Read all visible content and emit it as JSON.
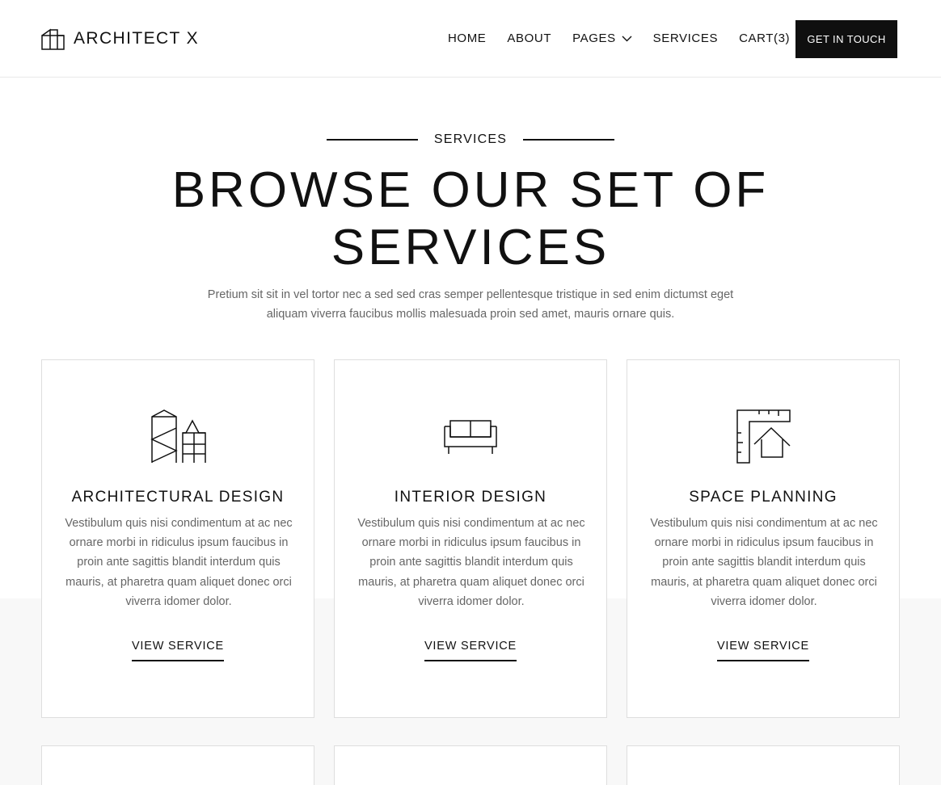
{
  "brand": {
    "name": "ARCHITECT X",
    "logo_icon": "building-outline-icon"
  },
  "nav": {
    "items": [
      {
        "label": "HOME"
      },
      {
        "label": "ABOUT"
      },
      {
        "label": "PAGES",
        "has_dropdown": true
      },
      {
        "label": "SERVICES"
      },
      {
        "label": "CART(3)"
      }
    ],
    "cta_label": "GET IN TOUCH"
  },
  "hero": {
    "eyebrow": "SERVICES",
    "title": "BROWSE OUR SET OF SERVICES",
    "description": "Pretium sit sit in vel tortor nec a sed sed cras semper pellentesque tristique in sed enim dictumst eget aliquam viverra faucibus mollis malesuada proin sed amet, mauris ornare quis."
  },
  "services": [
    {
      "icon": "tower-buildings-icon",
      "title": "ARCHITECTURAL DESIGN",
      "description": "Vestibulum quis nisi condimentum at ac nec ornare morbi in ridiculus ipsum faucibus in proin ante sagittis blandit interdum quis mauris, at pharetra quam aliquet donec orci viverra idomer dolor.",
      "link_label": "VIEW SERVICE"
    },
    {
      "icon": "sofa-icon",
      "title": "INTERIOR DESIGN",
      "description": "Vestibulum quis nisi condimentum at ac nec ornare morbi in ridiculus ipsum faucibus in proin ante sagittis blandit interdum quis mauris, at pharetra quam aliquet donec orci viverra idomer dolor.",
      "link_label": "VIEW SERVICE"
    },
    {
      "icon": "floor-plan-house-icon",
      "title": "SPACE PLANNING",
      "description": "Vestibulum quis nisi condimentum at ac nec ornare morbi in ridiculus ipsum faucibus in proin ante sagittis blandit interdum quis mauris, at pharetra quam aliquet donec orci viverra idomer dolor.",
      "link_label": "VIEW SERVICE"
    }
  ],
  "colors": {
    "text": "#111111",
    "muted": "#666666",
    "border": "#dedede",
    "band": "#f8f8f8",
    "cta_bg": "#0f0f0f"
  }
}
